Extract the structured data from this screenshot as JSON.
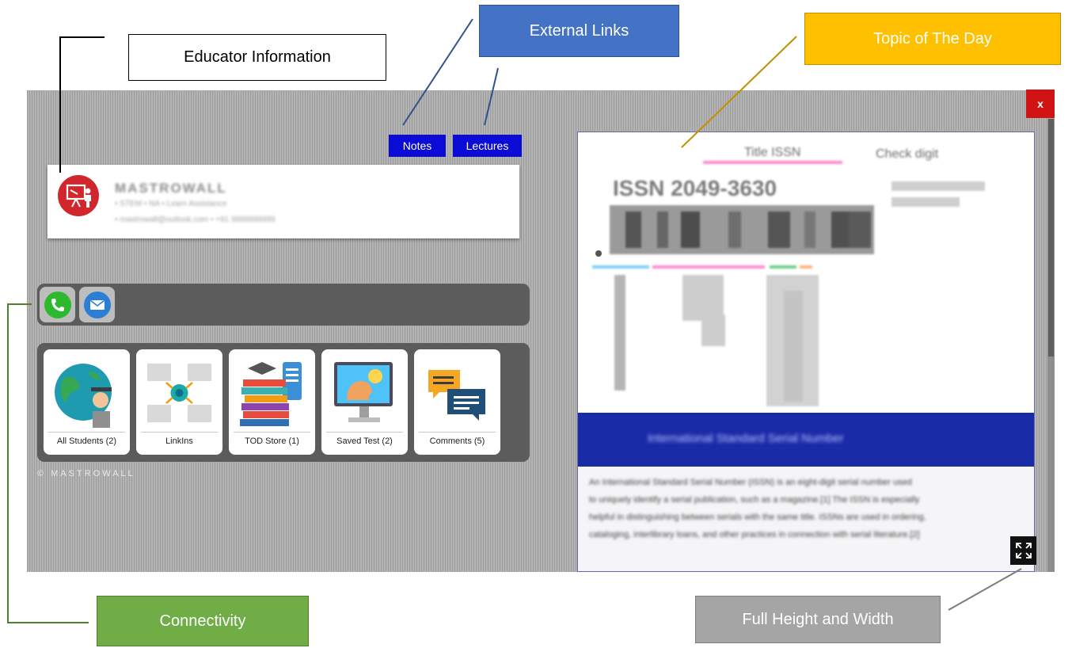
{
  "window": {
    "close_label": "x"
  },
  "external_links": {
    "notes_label": "Notes",
    "lectures_label": "Lectures"
  },
  "educator": {
    "name": "MASTROWALL",
    "line1": "• STEM • NA • Learn Assistance",
    "line2": "• mastrowall@outlook.com • +91 9999999999",
    "avatar_icon": "teacher-presentation-icon",
    "avatar_color": "#d1262b"
  },
  "connectivity": {
    "buttons": [
      {
        "icon": "phone-icon",
        "color": "#2db82d"
      },
      {
        "icon": "mail-icon",
        "color": "#2a7fd4"
      }
    ]
  },
  "tiles": [
    {
      "label": "All Students (2)",
      "icon": "globe-graduate-icon"
    },
    {
      "label": "LinkIns",
      "icon": "network-books-icon"
    },
    {
      "label": "TOD Store (1)",
      "icon": "books-stack-icon"
    },
    {
      "label": "Saved Test (2)",
      "icon": "idea-monitor-icon"
    },
    {
      "label": "Comments (5)",
      "icon": "chat-bubbles-icon"
    }
  ],
  "copyright": "© MASTROWALL",
  "topic": {
    "image_title": "Title ISSN",
    "check_digit_label": "Check digit",
    "issn_number": "ISSN 2049-3630",
    "banner_text": "International Standard Serial Number",
    "article_lines": [
      "An International Standard Serial Number (ISSN) is an eight-digit serial number used",
      "to uniquely identify a serial publication, such as a magazine.[1] The ISSN is especially",
      "helpful in distinguishing between serials with the same title. ISSNs are used in ordering,",
      "cataloging, interlibrary loans, and other practices in connection with serial literature.[2]"
    ]
  },
  "callouts": {
    "educator": "Educator Information",
    "external": "External Links",
    "topic": "Topic of The Day",
    "connectivity": "Connectivity",
    "fullscreen": "Full Height and Width"
  }
}
